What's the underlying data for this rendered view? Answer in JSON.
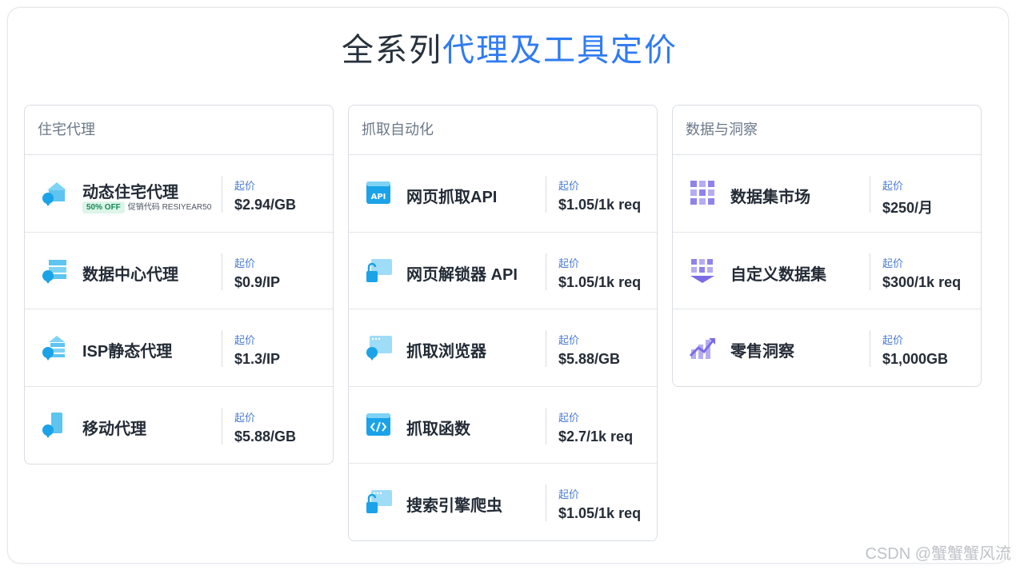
{
  "title": {
    "prefix": "全系列",
    "accent": "代理及工具定价"
  },
  "columns": [
    {
      "heading": "住宅代理",
      "items": [
        {
          "name": "动态住宅代理",
          "icon": "residential-proxy-icon",
          "promo_badge": "50% OFF",
          "promo_text": "促销代码 RESIYEAR50",
          "from": "起价",
          "price": "$2.94/GB"
        },
        {
          "name": "数据中心代理",
          "icon": "datacenter-proxy-icon",
          "from": "起价",
          "price": "$0.9/IP"
        },
        {
          "name": "ISP静态代理",
          "icon": "isp-proxy-icon",
          "from": "起价",
          "price": "$1.3/IP"
        },
        {
          "name": "移动代理",
          "icon": "mobile-proxy-icon",
          "from": "起价",
          "price": "$5.88/GB"
        }
      ]
    },
    {
      "heading": "抓取自动化",
      "items": [
        {
          "name": "网页抓取API",
          "icon": "api-icon",
          "from": "起价",
          "price": "$1.05/1k req"
        },
        {
          "name": "网页解锁器 API",
          "icon": "unlocker-icon",
          "from": "起价",
          "price": "$1.05/1k req"
        },
        {
          "name": "抓取浏览器",
          "icon": "browser-icon",
          "from": "起价",
          "price": "$5.88/GB"
        },
        {
          "name": "抓取函数",
          "icon": "code-icon",
          "from": "起价",
          "price": "$2.7/1k req"
        },
        {
          "name": "搜索引擎爬虫",
          "icon": "serp-icon",
          "from": "起价",
          "price": "$1.05/1k req"
        }
      ]
    },
    {
      "heading": "数据与洞察",
      "items": [
        {
          "name": "数据集市场",
          "icon": "dataset-grid-icon",
          "from": "起价",
          "price": "$250/月"
        },
        {
          "name": "自定义数据集",
          "icon": "custom-dataset-icon",
          "from": "起价",
          "price": "$300/1k req"
        },
        {
          "name": "零售洞察",
          "icon": "retail-chart-icon",
          "from": "起价",
          "price": "$1,000GB"
        }
      ]
    }
  ],
  "watermark": "CSDN @蟹蟹蟹风流",
  "colors": {
    "accent": "#2f7bf2",
    "icon_blue": "#1aa3e8",
    "icon_purple": "#7b6be6",
    "badge_bg": "#dcf5e8"
  }
}
